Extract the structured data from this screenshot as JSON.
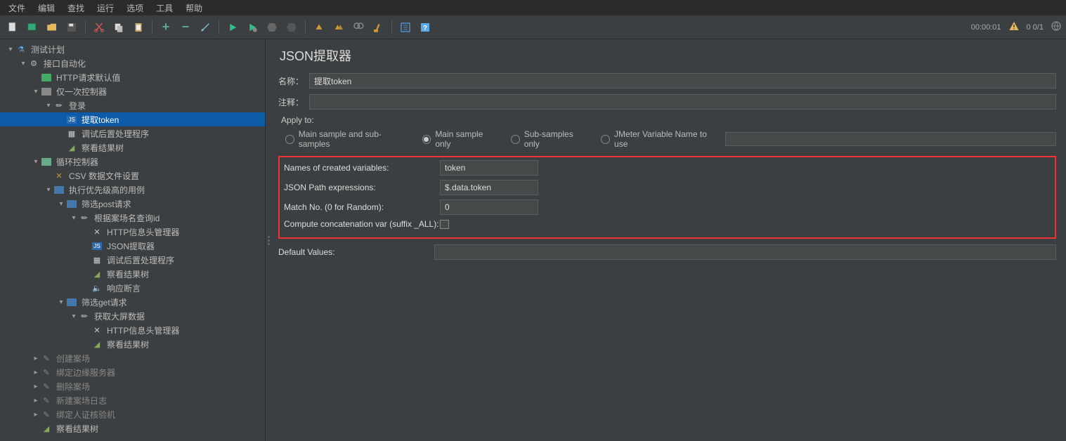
{
  "menu": [
    "文件",
    "编辑",
    "查找",
    "运行",
    "选项",
    "工具",
    "帮助"
  ],
  "status": {
    "time": "00:00:01",
    "counts": "0  0/1"
  },
  "tree": [
    {
      "d": 0,
      "c": "open",
      "i": "flask",
      "t": "测试计划"
    },
    {
      "d": 1,
      "c": "open",
      "i": "gear",
      "t": "接口自动化"
    },
    {
      "d": 2,
      "c": "none",
      "i": "http",
      "t": "HTTP请求默认值"
    },
    {
      "d": 2,
      "c": "open",
      "i": "once",
      "t": "仅一次控制器"
    },
    {
      "d": 3,
      "c": "open",
      "i": "pencil",
      "t": "登录"
    },
    {
      "d": 4,
      "c": "none",
      "i": "json",
      "t": "提取token",
      "sel": true
    },
    {
      "d": 4,
      "c": "none",
      "i": "debug",
      "t": "调试后置处理程序"
    },
    {
      "d": 4,
      "c": "none",
      "i": "results",
      "t": "察看结果树"
    },
    {
      "d": 2,
      "c": "open",
      "i": "loop",
      "t": "循环控制器"
    },
    {
      "d": 3,
      "c": "none",
      "i": "csv",
      "t": "CSV 数据文件设置"
    },
    {
      "d": 3,
      "c": "open",
      "i": "switch",
      "t": "执行优先级高的用例"
    },
    {
      "d": 4,
      "c": "open",
      "i": "switch",
      "t": "筛选post请求"
    },
    {
      "d": 5,
      "c": "open",
      "i": "pencil",
      "t": "根据案场名查询id"
    },
    {
      "d": 6,
      "c": "none",
      "i": "header",
      "t": "HTTP信息头管理器"
    },
    {
      "d": 6,
      "c": "none",
      "i": "json",
      "t": "JSON提取器"
    },
    {
      "d": 6,
      "c": "none",
      "i": "debug",
      "t": "调试后置处理程序"
    },
    {
      "d": 6,
      "c": "none",
      "i": "results",
      "t": "察看结果树"
    },
    {
      "d": 6,
      "c": "none",
      "i": "assert",
      "t": "响应断言"
    },
    {
      "d": 4,
      "c": "open",
      "i": "switch",
      "t": "筛选get请求"
    },
    {
      "d": 5,
      "c": "open",
      "i": "pencil",
      "t": "获取大屏数据"
    },
    {
      "d": 6,
      "c": "none",
      "i": "header",
      "t": "HTTP信息头管理器"
    },
    {
      "d": 6,
      "c": "none",
      "i": "results",
      "t": "察看结果树"
    },
    {
      "d": 2,
      "c": "closed",
      "i": "dis",
      "t": "创建案场",
      "dis": true
    },
    {
      "d": 2,
      "c": "closed",
      "i": "dis",
      "t": "绑定边缘服务器",
      "dis": true
    },
    {
      "d": 2,
      "c": "closed",
      "i": "dis",
      "t": "删除案场",
      "dis": true
    },
    {
      "d": 2,
      "c": "closed",
      "i": "dis",
      "t": "新建案场日志",
      "dis": true
    },
    {
      "d": 2,
      "c": "closed",
      "i": "dis",
      "t": "绑定人证核验机",
      "dis": true
    },
    {
      "d": 2,
      "c": "none",
      "i": "results",
      "t": "察看结果树"
    }
  ],
  "panel": {
    "title": "JSON提取器",
    "name_label": "名称：",
    "name_value": "提取token",
    "comment_label": "注释：",
    "comment_value": "",
    "apply_label": "Apply to:",
    "radios": [
      "Main sample and sub-samples",
      "Main sample only",
      "Sub-samples only",
      "JMeter Variable Name to use"
    ],
    "fields": {
      "names_label": "Names of created variables:",
      "names_value": "token",
      "json_label": "JSON Path expressions:",
      "json_value": "$.data.token",
      "match_label": "Match No. (0 for Random):",
      "match_value": "0",
      "concat_label": "Compute concatenation var (suffix _ALL):",
      "default_label": "Default Values:",
      "default_value": ""
    }
  }
}
